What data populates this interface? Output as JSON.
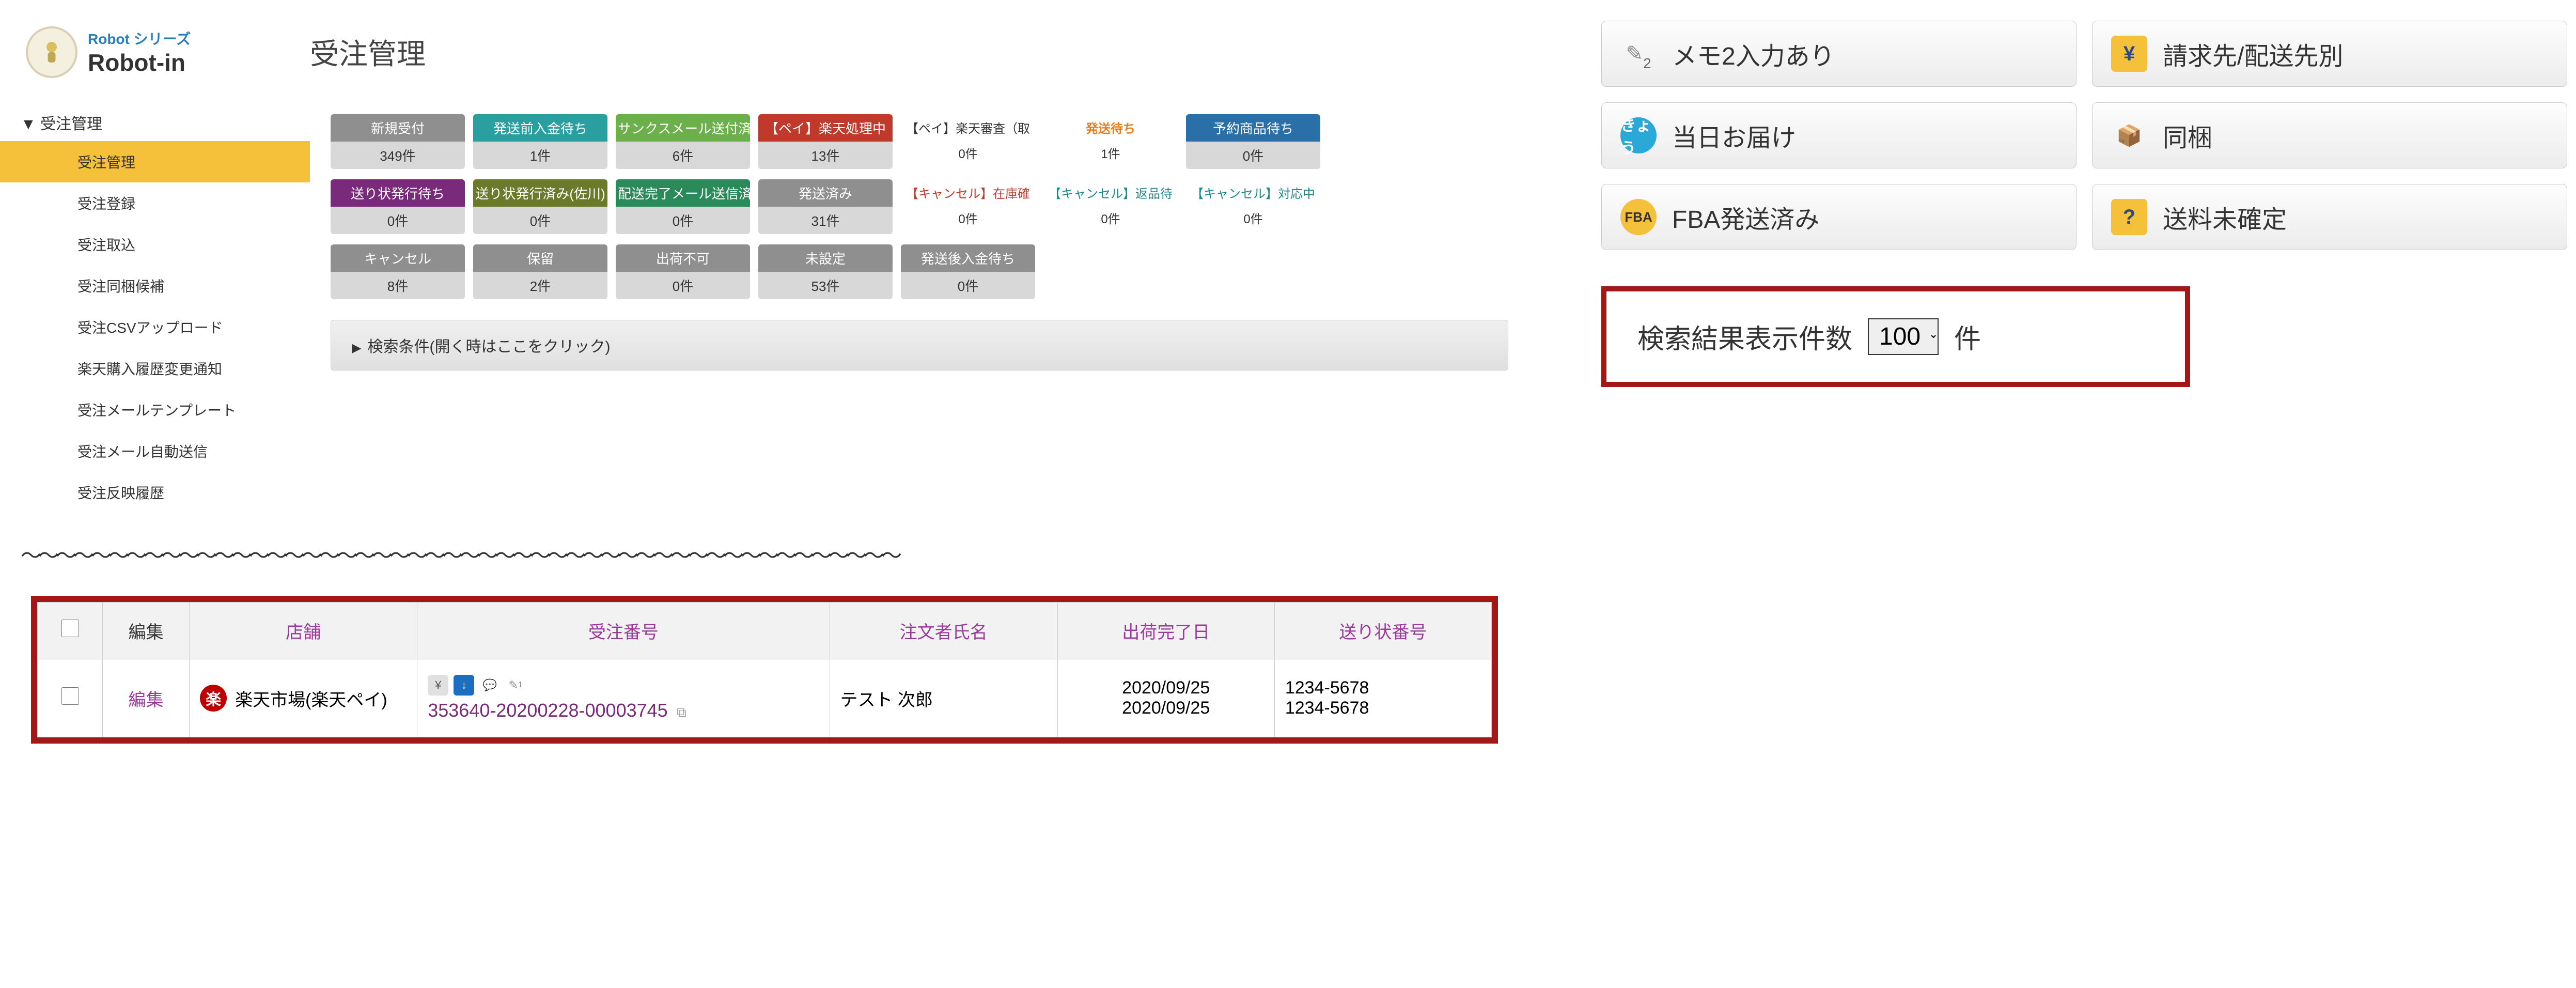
{
  "logo": {
    "line1": "Robot シリーズ",
    "line2": "Robot-in"
  },
  "page_title": "受注管理",
  "nav_header": "▼ 受注管理",
  "nav": [
    "受注管理",
    "受注登録",
    "受注取込",
    "受注同梱候補",
    "受注CSVアップロード",
    "楽天購入履歴変更通知",
    "受注メールテンプレート",
    "受注メール自動送信",
    "受注反映履歴"
  ],
  "status": {
    "r1": [
      {
        "c": "gray",
        "t": "新規受付",
        "n": "349件"
      },
      {
        "c": "teal",
        "t": "発送前入金待ち",
        "n": "1件"
      },
      {
        "c": "green",
        "t": "サンクスメール送付済",
        "n": "6件"
      },
      {
        "c": "red",
        "t": "【ペイ】楽天処理中",
        "n": "13件"
      },
      {
        "text": true,
        "t1": "【ペイ】楽天審査（取",
        "t2": "0件"
      },
      {
        "text": true,
        "orange": true,
        "t1": "発送待ち",
        "t2": "1件"
      },
      {
        "c": "blue",
        "t": "予約商品待ち",
        "n": "0件"
      }
    ],
    "r2": [
      {
        "c": "purple",
        "t": "送り状発行待ち",
        "n": "0件"
      },
      {
        "c": "olive",
        "t": "送り状発行済み(佐川)",
        "n": "0件"
      },
      {
        "c": "deepgreen",
        "t": "配送完了メール送信済",
        "n": "0件"
      },
      {
        "c": "gray",
        "t": "発送済み",
        "n": "31件"
      },
      {
        "text": true,
        "t1": "【キャンセル】在庫確",
        "t2": "0件",
        "cls": "red"
      },
      {
        "text": true,
        "t1": "【キャンセル】返品待",
        "t2": "0件",
        "cls": "teal"
      },
      {
        "text": true,
        "t1": "【キャンセル】対応中",
        "t2": "0件",
        "cls": "teal"
      }
    ],
    "r3": [
      {
        "c": "gray",
        "t": "キャンセル",
        "n": "8件"
      },
      {
        "c": "gray",
        "t": "保留",
        "n": "2件"
      },
      {
        "c": "gray",
        "t": "出荷不可",
        "n": "0件"
      },
      {
        "c": "gray",
        "t": "未設定",
        "n": "53件"
      },
      {
        "c": "gray",
        "t": "発送後入金待ち",
        "n": "0件"
      }
    ]
  },
  "search_bar": "検索条件(開く時はここをクリック)",
  "table": {
    "headers": [
      "",
      "編集",
      "店舗",
      "受注番号",
      "注文者氏名",
      "出荷完了日",
      "送り状番号"
    ],
    "row": {
      "edit": "編集",
      "shop": "楽天市場(楽天ペイ)",
      "order_no": "353640-20200228-00003745",
      "customer": "テスト 次郎",
      "ship_dates": [
        "2020/09/25",
        "2020/09/25"
      ],
      "slip": [
        "1234-5678",
        "1234-5678"
      ]
    }
  },
  "rbuttons": [
    {
      "icon": "pencil",
      "label": "メモ2入力あり",
      "sub": "2"
    },
    {
      "icon": "yen",
      "label": "請求先/配送先別"
    },
    {
      "icon": "kyo",
      "label": "当日お届け",
      "glyph": "きょう"
    },
    {
      "icon": "box",
      "label": "同梱"
    },
    {
      "icon": "fba",
      "label": "FBA発送済み",
      "glyph": "FBA"
    },
    {
      "icon": "q",
      "label": "送料未確定"
    }
  ],
  "count": {
    "label": "検索結果表示件数",
    "value": "100",
    "suffix": "件"
  }
}
